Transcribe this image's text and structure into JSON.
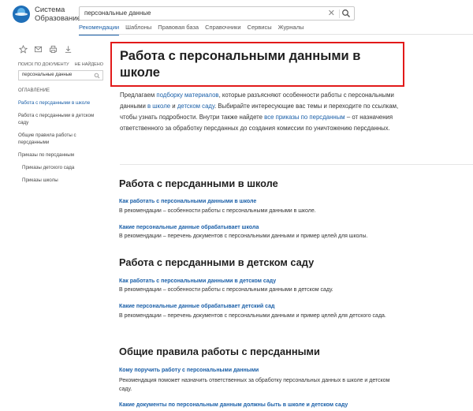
{
  "logo": {
    "line1": "Система",
    "line2": "Образование"
  },
  "search": {
    "value": "персональные данные"
  },
  "nav": {
    "items": [
      "Рекомендации",
      "Шаблоны",
      "Правовая база",
      "Справочники",
      "Сервисы",
      "Журналы"
    ]
  },
  "sidebar": {
    "doc_search_label": "ПОИСК ПО ДОКУМЕНТУ",
    "not_found": "НЕ НАЙДЕНО",
    "doc_search_value": "персональные данные",
    "toc_title": "ОГЛАВЛЕНИЕ",
    "toc": [
      "Работа с персданными в школе",
      "Работа с персданными в детском саду",
      "Общие правила работы с персданными",
      "Приказы по персданным",
      "Приказы детского сада",
      "Приказы школы"
    ]
  },
  "main": {
    "title": "Работа с персональными данными в школе",
    "intro": {
      "p1": "Предлагаем ",
      "l1": "подборку материалов",
      "p2": ", которые разъясняют особенности работы с персональными данными ",
      "l2": "в школе",
      "p3": " и ",
      "l3": "детском саду",
      "p4": ". Выбирайте интересующие вас темы и переходите по ссылкам, чтобы узнать подробности. Внутри также найдете ",
      "l4": "все приказы по персданным",
      "p5": " – от назначения ответственного за обработку персданных до создания комиссии по уничтожению персданных."
    },
    "sections": [
      {
        "heading": "Работа с персданными в школе",
        "items": [
          {
            "link": "Как работать с персональными данными в школе",
            "desc": "В рекомендации – особенности работы с персональными данными в школе."
          },
          {
            "link": "Какие персональные данные обрабатывает школа",
            "desc": "В рекомендации – перечень документов с персональными данными и пример целей для школы."
          }
        ]
      },
      {
        "heading": "Работа с персданными в детском саду",
        "items": [
          {
            "link": "Как работать с персональными данными в детском саду",
            "desc": "В рекомендации – особенности работы с персональными данными в детском саду."
          },
          {
            "link": "Какие персональные данные обрабатывает детский сад",
            "desc": "В рекомендации – перечень документов с персональными данными и пример целей для детского сада."
          }
        ]
      },
      {
        "heading": "Общие правила работы с персданными",
        "items": [
          {
            "link": "Кому поручить работу с персональными данными",
            "desc": "Рекомендация поможет назначить ответственных за обработку персональных данных в школе и детском саду."
          },
          {
            "link": "Какие документы по персональным данным должны быть в школе и детском саду",
            "desc": ""
          }
        ]
      }
    ]
  },
  "colors": {
    "accent": "#1a5fa8",
    "highlight_box": "#e21a1a"
  }
}
